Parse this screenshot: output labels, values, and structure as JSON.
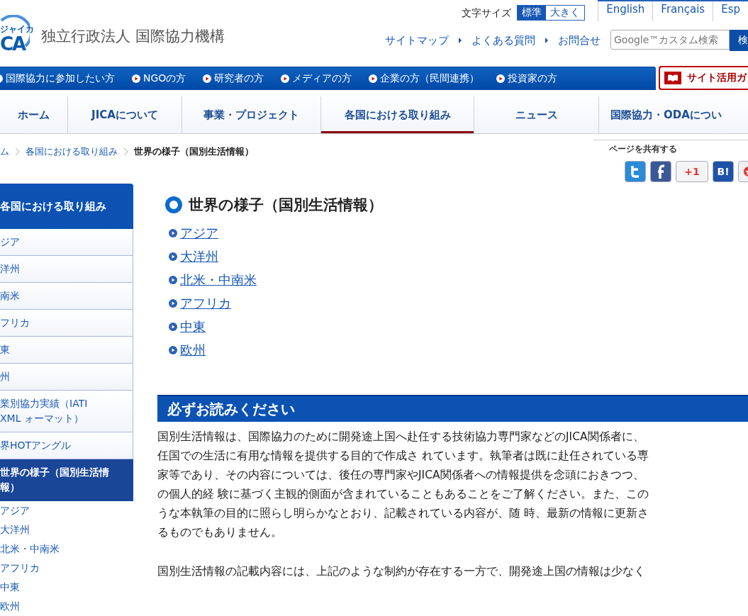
{
  "logo": {
    "text": "CA",
    "ruby": "ジャイカ"
  },
  "org_name": "独立行政法人 国際協力機構",
  "font_size": {
    "label": "文字サイズ",
    "options": [
      {
        "label": "標準",
        "selected": true
      },
      {
        "label": "大きく",
        "selected": false
      }
    ]
  },
  "languages": [
    "English",
    "Français",
    "Esp"
  ],
  "utility_links": [
    "サイトマップ",
    "よくある質問",
    "お問合せ"
  ],
  "search": {
    "placeholder": "Google™カスタム検索",
    "button": "検"
  },
  "audience_nav": [
    "国際協力に参加したい方",
    "NGOの方",
    "研究者の方",
    "メディアの方",
    "企業の方（民間連携）",
    "投資家の方"
  ],
  "guide_button": "サイト活用ガ",
  "main_nav": [
    {
      "label": "ホーム",
      "selected": false
    },
    {
      "label": "JICAについて",
      "selected": false
    },
    {
      "label": "事業・プロジェクト",
      "selected": false
    },
    {
      "label": "各国における取り組み",
      "selected": true
    },
    {
      "label": "ニュース",
      "selected": false
    },
    {
      "label": "国際協力・ODAについ",
      "selected": false
    }
  ],
  "breadcrumb": [
    {
      "label": "ム",
      "link": true
    },
    {
      "label": "各国における取り組み",
      "link": true
    },
    {
      "label": "世界の様子（国別生活情報）",
      "link": false
    }
  ],
  "share": {
    "label": "ページを共有する",
    "buttons": [
      {
        "kind": "twitter"
      },
      {
        "kind": "facebook"
      },
      {
        "kind": "gplus",
        "label": "+1"
      },
      {
        "kind": "hatena",
        "label": "B!"
      },
      {
        "kind": "bookmark"
      }
    ]
  },
  "sidebar": {
    "title": "各国における取り組み",
    "items": [
      {
        "label": "ジア",
        "selected": false
      },
      {
        "label": "洋州",
        "selected": false
      },
      {
        "label": "南米",
        "selected": false
      },
      {
        "label": "フリカ",
        "selected": false
      },
      {
        "label": "東",
        "selected": false
      },
      {
        "label": "州",
        "selected": false
      },
      {
        "label": "業別協力実績（IATI XML ォーマット）",
        "selected": false
      },
      {
        "label": "界HOTアングル",
        "selected": false
      },
      {
        "label": "世界の様子（国別生活情報）",
        "selected": true,
        "children": [
          "アジア",
          "大洋州",
          "北米・中南米",
          "アフリカ",
          "中東",
          "欧州"
        ]
      }
    ]
  },
  "page_title": "世界の様子（国別生活情報）",
  "region_links": [
    "アジア",
    "大洋州",
    "北米・中南米",
    "アフリカ",
    "中東",
    "欧州"
  ],
  "notice": {
    "heading": "必ずお読みください",
    "paragraphs": [
      [
        "国別生活情報は、国際協力のために開発途上国へ赴任する技術協力専門家などのJICA関係者に、",
        "任国での生活に有用な情報を提供する目的で作成さ れています。執筆者は既に赴任されている専",
        "家等であり、その内容については、後任の専門家やJICA関係者への情報提供を念頭におきつつ、",
        "の個人的経 験に基づく主観的側面が含まれていることもあることをご了解ください。また、この",
        "うな本執筆の目的に照らし明らかなとおり、記載されている内容が、随 時、最新の情報に更新さ",
        "るものでもありません。"
      ],
      [
        "国別生活情報の記載内容には、上記のような制約が存在する一方で、開発途上国の情報は少なく"
      ]
    ]
  }
}
